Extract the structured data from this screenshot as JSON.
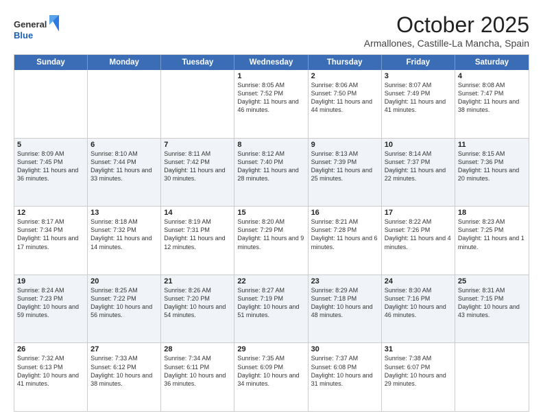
{
  "header": {
    "title": "October 2025",
    "subtitle": "Armallones, Castille-La Mancha, Spain",
    "logo_general": "General",
    "logo_blue": "Blue"
  },
  "days_of_week": [
    "Sunday",
    "Monday",
    "Tuesday",
    "Wednesday",
    "Thursday",
    "Friday",
    "Saturday"
  ],
  "rows": [
    [
      {
        "day": "",
        "text": ""
      },
      {
        "day": "",
        "text": ""
      },
      {
        "day": "",
        "text": ""
      },
      {
        "day": "1",
        "text": "Sunrise: 8:05 AM\nSunset: 7:52 PM\nDaylight: 11 hours and 46 minutes."
      },
      {
        "day": "2",
        "text": "Sunrise: 8:06 AM\nSunset: 7:50 PM\nDaylight: 11 hours and 44 minutes."
      },
      {
        "day": "3",
        "text": "Sunrise: 8:07 AM\nSunset: 7:49 PM\nDaylight: 11 hours and 41 minutes."
      },
      {
        "day": "4",
        "text": "Sunrise: 8:08 AM\nSunset: 7:47 PM\nDaylight: 11 hours and 38 minutes."
      }
    ],
    [
      {
        "day": "5",
        "text": "Sunrise: 8:09 AM\nSunset: 7:45 PM\nDaylight: 11 hours and 36 minutes."
      },
      {
        "day": "6",
        "text": "Sunrise: 8:10 AM\nSunset: 7:44 PM\nDaylight: 11 hours and 33 minutes."
      },
      {
        "day": "7",
        "text": "Sunrise: 8:11 AM\nSunset: 7:42 PM\nDaylight: 11 hours and 30 minutes."
      },
      {
        "day": "8",
        "text": "Sunrise: 8:12 AM\nSunset: 7:40 PM\nDaylight: 11 hours and 28 minutes."
      },
      {
        "day": "9",
        "text": "Sunrise: 8:13 AM\nSunset: 7:39 PM\nDaylight: 11 hours and 25 minutes."
      },
      {
        "day": "10",
        "text": "Sunrise: 8:14 AM\nSunset: 7:37 PM\nDaylight: 11 hours and 22 minutes."
      },
      {
        "day": "11",
        "text": "Sunrise: 8:15 AM\nSunset: 7:36 PM\nDaylight: 11 hours and 20 minutes."
      }
    ],
    [
      {
        "day": "12",
        "text": "Sunrise: 8:17 AM\nSunset: 7:34 PM\nDaylight: 11 hours and 17 minutes."
      },
      {
        "day": "13",
        "text": "Sunrise: 8:18 AM\nSunset: 7:32 PM\nDaylight: 11 hours and 14 minutes."
      },
      {
        "day": "14",
        "text": "Sunrise: 8:19 AM\nSunset: 7:31 PM\nDaylight: 11 hours and 12 minutes."
      },
      {
        "day": "15",
        "text": "Sunrise: 8:20 AM\nSunset: 7:29 PM\nDaylight: 11 hours and 9 minutes."
      },
      {
        "day": "16",
        "text": "Sunrise: 8:21 AM\nSunset: 7:28 PM\nDaylight: 11 hours and 6 minutes."
      },
      {
        "day": "17",
        "text": "Sunrise: 8:22 AM\nSunset: 7:26 PM\nDaylight: 11 hours and 4 minutes."
      },
      {
        "day": "18",
        "text": "Sunrise: 8:23 AM\nSunset: 7:25 PM\nDaylight: 11 hours and 1 minute."
      }
    ],
    [
      {
        "day": "19",
        "text": "Sunrise: 8:24 AM\nSunset: 7:23 PM\nDaylight: 10 hours and 59 minutes."
      },
      {
        "day": "20",
        "text": "Sunrise: 8:25 AM\nSunset: 7:22 PM\nDaylight: 10 hours and 56 minutes."
      },
      {
        "day": "21",
        "text": "Sunrise: 8:26 AM\nSunset: 7:20 PM\nDaylight: 10 hours and 54 minutes."
      },
      {
        "day": "22",
        "text": "Sunrise: 8:27 AM\nSunset: 7:19 PM\nDaylight: 10 hours and 51 minutes."
      },
      {
        "day": "23",
        "text": "Sunrise: 8:29 AM\nSunset: 7:18 PM\nDaylight: 10 hours and 48 minutes."
      },
      {
        "day": "24",
        "text": "Sunrise: 8:30 AM\nSunset: 7:16 PM\nDaylight: 10 hours and 46 minutes."
      },
      {
        "day": "25",
        "text": "Sunrise: 8:31 AM\nSunset: 7:15 PM\nDaylight: 10 hours and 43 minutes."
      }
    ],
    [
      {
        "day": "26",
        "text": "Sunrise: 7:32 AM\nSunset: 6:13 PM\nDaylight: 10 hours and 41 minutes."
      },
      {
        "day": "27",
        "text": "Sunrise: 7:33 AM\nSunset: 6:12 PM\nDaylight: 10 hours and 38 minutes."
      },
      {
        "day": "28",
        "text": "Sunrise: 7:34 AM\nSunset: 6:11 PM\nDaylight: 10 hours and 36 minutes."
      },
      {
        "day": "29",
        "text": "Sunrise: 7:35 AM\nSunset: 6:09 PM\nDaylight: 10 hours and 34 minutes."
      },
      {
        "day": "30",
        "text": "Sunrise: 7:37 AM\nSunset: 6:08 PM\nDaylight: 10 hours and 31 minutes."
      },
      {
        "day": "31",
        "text": "Sunrise: 7:38 AM\nSunset: 6:07 PM\nDaylight: 10 hours and 29 minutes."
      },
      {
        "day": "",
        "text": ""
      }
    ]
  ]
}
